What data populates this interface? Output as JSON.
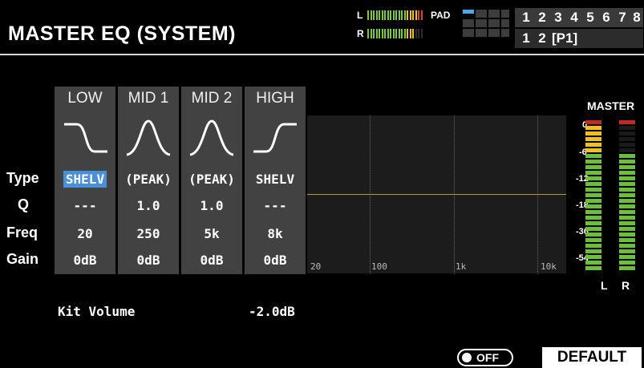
{
  "header": {
    "title": "MASTER EQ (SYSTEM)",
    "level_l_label": "L",
    "level_r_label": "R",
    "pad_label": "PAD",
    "kit_numbers_row1": [
      "1",
      "2",
      "3",
      "4",
      "5",
      "6",
      "7",
      "8"
    ],
    "kit_numbers_row2": [
      "1",
      "2"
    ],
    "page_label": "[P1]"
  },
  "bands": [
    {
      "name": "LOW",
      "type": "SHELV",
      "q": "---",
      "freq": "20",
      "gain": "0dB",
      "selected": true,
      "curve": "low-shelf"
    },
    {
      "name": "MID 1",
      "type": "(PEAK)",
      "q": "1.0",
      "freq": "250",
      "gain": "0dB",
      "selected": false,
      "curve": "peak"
    },
    {
      "name": "MID 2",
      "type": "(PEAK)",
      "q": "1.0",
      "freq": "5k",
      "gain": "0dB",
      "selected": false,
      "curve": "peak"
    },
    {
      "name": "HIGH",
      "type": "SHELV",
      "q": "---",
      "freq": "8k",
      "gain": "0dB",
      "selected": false,
      "curve": "high-shelf"
    }
  ],
  "row_labels": {
    "type": "Type",
    "q": "Q",
    "freq": "Freq",
    "gain": "Gain"
  },
  "graph": {
    "ticks": [
      "20",
      "100",
      "1k",
      "10k"
    ],
    "curve_color": "#b89a2a"
  },
  "meter": {
    "label": "MASTER",
    "scale": [
      "0",
      "-6",
      "-12",
      "-18",
      "-36",
      "-54"
    ],
    "channel_l": "L",
    "channel_r": "R",
    "colors": {
      "green": "#6cbf3c",
      "yellow": "#f0c020",
      "red": "#c0282a"
    }
  },
  "kit_volume": {
    "label": "Kit Volume",
    "value": "-2.0dB"
  },
  "footer": {
    "toggle_label": "OFF",
    "default_label": "DEFAULT"
  },
  "colors": {
    "selected": "#4a90d9",
    "panel": "#424242"
  }
}
